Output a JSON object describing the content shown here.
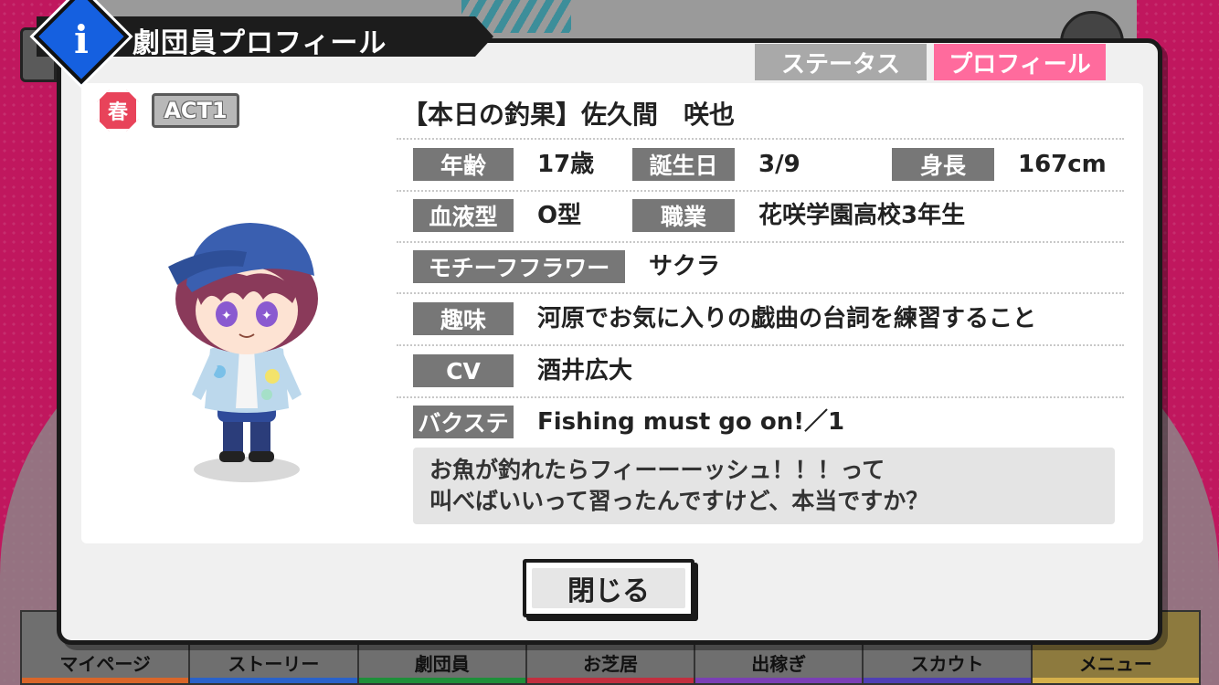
{
  "header": {
    "title": "劇団員プロフィール",
    "icon": "info-icon"
  },
  "tabs": [
    {
      "label": "ステータス",
      "active": false
    },
    {
      "label": "プロフィール",
      "active": true
    }
  ],
  "badges": {
    "season": "春",
    "act": "ACT1"
  },
  "profile": {
    "name": "【本日の釣果】佐久間　咲也",
    "rows": {
      "age_label": "年齢",
      "age_value": "17歳",
      "birthday_label": "誕生日",
      "birthday_value": "3/9",
      "height_label": "身長",
      "height_value": "167cm",
      "blood_label": "血液型",
      "blood_value": "O型",
      "job_label": "職業",
      "job_value": "花咲学園高校3年生",
      "flower_label": "モチーフフラワー",
      "flower_value": "サクラ",
      "hobby_label": "趣味",
      "hobby_value": "河原でお気に入りの戯曲の台詞を練習すること",
      "cv_label": "CV",
      "cv_value": "酒井広大",
      "backstage_label": "バクステ",
      "backstage_value": "Fishing must go on!／1"
    },
    "quote_lines": [
      "お魚が釣れたらフィーーーッシュ！！！って",
      "叫べばいいって習ったんですけど、本当ですか？"
    ]
  },
  "close_label": "閉じる",
  "bottom_nav": [
    {
      "label": "マイページ",
      "color": "#d9662a"
    },
    {
      "label": "ストーリー",
      "color": "#2a62c9"
    },
    {
      "label": "劇団員",
      "color": "#1f8f3a"
    },
    {
      "label": "お芝居",
      "color": "#c22f3f"
    },
    {
      "label": "出稼ぎ",
      "color": "#7a3fb5"
    },
    {
      "label": "スカウト",
      "color": "#4f3fb5"
    },
    {
      "label": "メニュー",
      "color": "#d6b04a"
    }
  ],
  "colors": {
    "accent_pink": "#ff6b9d",
    "info_blue": "#1560e0",
    "season_red": "#e8435a"
  }
}
